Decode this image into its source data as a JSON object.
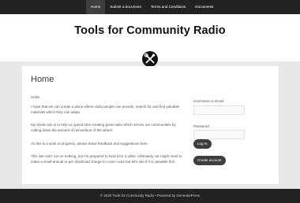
{
  "nav": {
    "items": [
      "Home",
      "Submit a document",
      "Terms and Conditions",
      "Documents"
    ]
  },
  "site": {
    "title": "Tools for Community Radio",
    "logo_icon": "wrench-screwdriver-icon"
  },
  "page": {
    "title": "Home",
    "paragraphs": [
      "Hello!",
      "I hope that we can create a place where radio people can provide, search for and find valuable materials which they can adapt.",
      "My whole aim is to help us spend time creating great radio which serves our communities by cutting down the amount of reinvention of the wheel.",
      "As this is a work in progress, please leave feedback and suggestions here",
      "This site can't run on nothing, but I'm prepared to fund it for a while. Ultimately, we might need to make a small annual or per download charge to cover costs but let's see if it is valuable first."
    ]
  },
  "login": {
    "username_label": "Username or Email",
    "password_label": "Password",
    "login_button": "Log In",
    "create_account_button": "Create account"
  },
  "footer": {
    "text": "© 2020 Tools for Community Radio • Powered by GeneratePress"
  },
  "colors": {
    "bar_background": "#222222",
    "page_background": "#e8e8e8",
    "button": "#3d3d3d"
  }
}
